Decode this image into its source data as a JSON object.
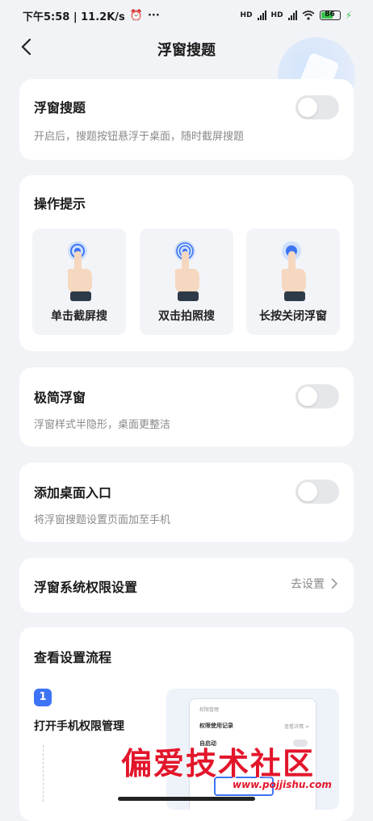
{
  "status_bar": {
    "time_speed": "下午5:58 | 11.2K/s",
    "alarm_icon": "alarm-icon",
    "more": "···",
    "network_left": "HD",
    "network_right": "HD",
    "battery": "86"
  },
  "header": {
    "title": "浮窗搜题",
    "back_icon": "back-icon"
  },
  "floating_search": {
    "title": "浮窗搜题",
    "subtitle": "开启后，搜题按钮悬浮于桌面，随时截屏搜题",
    "enabled": false
  },
  "tips": {
    "title": "操作提示",
    "items": [
      {
        "label": "单击截屏搜",
        "icon": "tap-hand-icon"
      },
      {
        "label": "双击拍照搜",
        "icon": "double-tap-hand-icon"
      },
      {
        "label": "长按关闭浮窗",
        "icon": "long-press-hand-icon"
      }
    ]
  },
  "minimal_float": {
    "title": "极简浮窗",
    "subtitle": "浮窗样式半隐形，桌面更整洁",
    "enabled": false
  },
  "desktop_entry": {
    "title": "添加桌面入口",
    "subtitle": "将浮窗搜题设置页面加至手机",
    "enabled": false
  },
  "permission": {
    "title": "浮窗系统权限设置",
    "action": "去设置"
  },
  "setup_flow": {
    "title": "查看设置流程",
    "step_number": "1",
    "step_text": "打开手机权限管理",
    "mock": {
      "header": "权限管理",
      "rows": [
        "权限使用记录",
        "自启动"
      ],
      "row_action": "查看详情 >"
    }
  },
  "watermark": {
    "text": "偏爱技术社区",
    "url": "www.pojjishu.com"
  },
  "colors": {
    "accent": "#3d73f5",
    "watermark": "#e2162b",
    "toggle_off": "#e6e7ea"
  }
}
